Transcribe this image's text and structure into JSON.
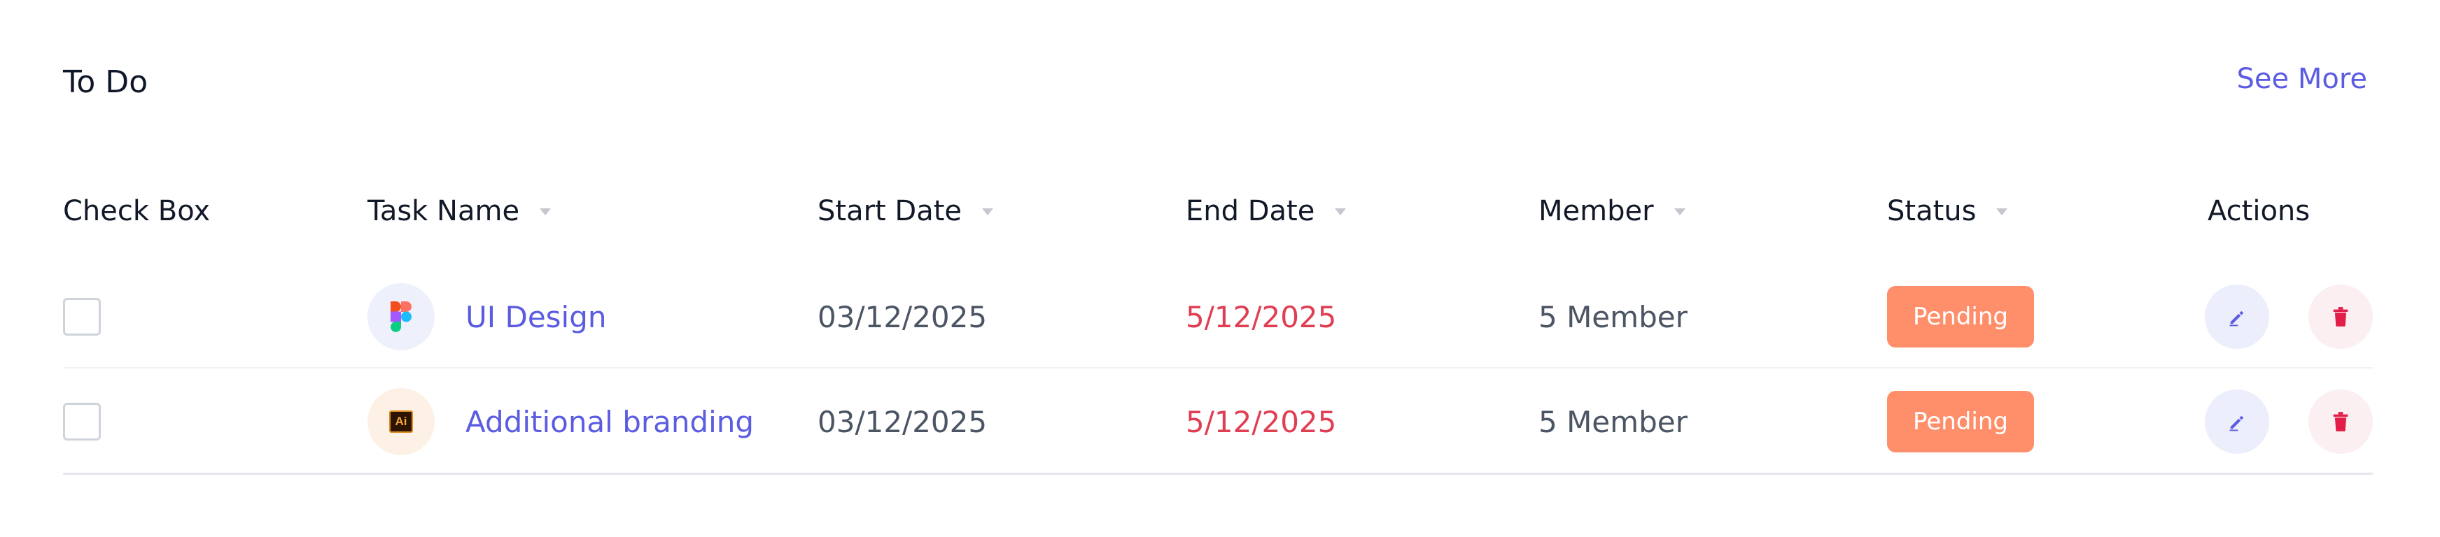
{
  "header": {
    "title": "To Do",
    "see_more": "See More"
  },
  "columns": [
    {
      "label": "Check Box",
      "sortable": false
    },
    {
      "label": "Task Name",
      "sortable": true
    },
    {
      "label": "Start Date",
      "sortable": true
    },
    {
      "label": "End Date",
      "sortable": true
    },
    {
      "label": "Member",
      "sortable": true
    },
    {
      "label": "Status",
      "sortable": true
    },
    {
      "label": "Actions",
      "sortable": false
    }
  ],
  "rows": [
    {
      "checked": false,
      "icon": "figma-icon",
      "task_name": "UI Design",
      "start_date": "03/12/2025",
      "end_date": "5/12/2025",
      "member": "5 Member",
      "status": "Pending"
    },
    {
      "checked": false,
      "icon": "adobe-illustrator-icon",
      "icon_text": "Ai",
      "task_name": "Additional branding",
      "start_date": "03/12/2025",
      "end_date": "5/12/2025",
      "member": "5 Member",
      "status": "Pending"
    }
  ],
  "colors": {
    "accent": "#5b5ce2",
    "end_date": "#e03e52",
    "status_pending": "#ff8f6b",
    "delete": "#e11d48"
  }
}
